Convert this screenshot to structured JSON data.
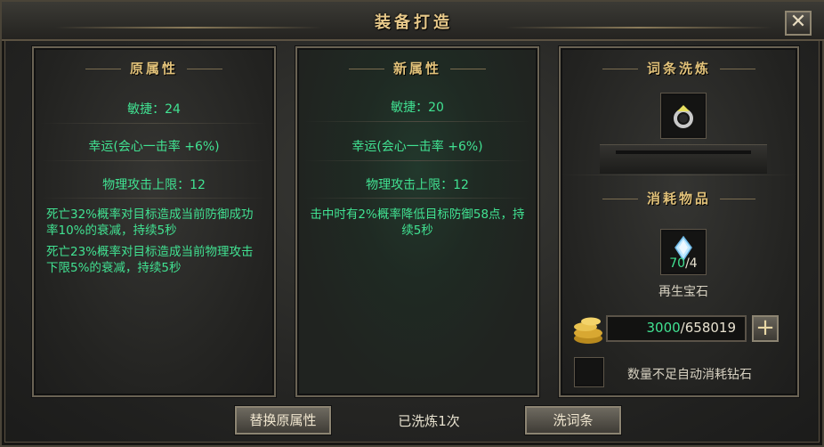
{
  "window": {
    "title": "装备打造",
    "close_icon": "close-icon"
  },
  "original": {
    "header": "原属性",
    "stats": [
      "敏捷：24",
      "幸运(会心一击率 +6%)",
      "物理攻击上限：12"
    ],
    "effects": [
      "死亡32%概率对目标造成当前防御成功率10%的衰减，持续5秒",
      "死亡23%概率对目标造成当前物理攻击下限5%的衰减，持续5秒"
    ]
  },
  "new": {
    "header": "新属性",
    "stats": [
      "敏捷：20",
      "幸运(会心一击率 +6%)",
      "物理攻击上限：12"
    ],
    "effects": [
      "击中时有2%概率降低目标防御58点，持续5秒"
    ]
  },
  "refine": {
    "header": "词条洗炼",
    "item_icon": "ring-icon",
    "consume_header": "消耗物品",
    "material_icon": "gem-icon",
    "material_owned": "70",
    "material_required": "/4",
    "material_name": "再生宝石",
    "gold_icon": "gold-coins-icon",
    "gold_owned": "3000",
    "gold_total": "/658019",
    "plus_label": "+",
    "auto_label": "数量不足自动消耗钻石"
  },
  "footer": {
    "replace_button": "替换原属性",
    "status": "已洗炼1次",
    "wash_button": "洗词条"
  },
  "colors": {
    "stat_green": "#41e292",
    "gold": "#e2c27a"
  }
}
